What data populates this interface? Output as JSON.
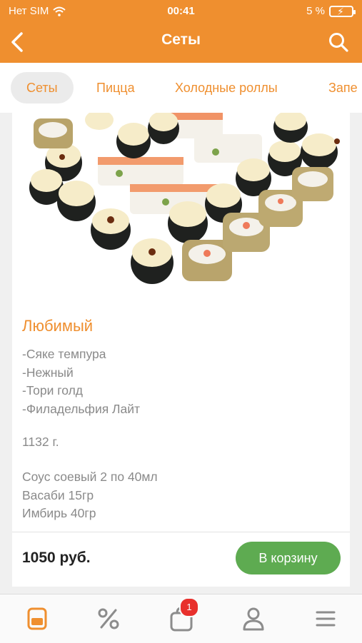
{
  "status_bar": {
    "carrier": "Нет SIM",
    "time": "00:41",
    "battery": "5 %"
  },
  "header": {
    "title": "Сеты",
    "back_icon": "chevron-left-icon",
    "search_icon": "search-icon"
  },
  "tabs": [
    {
      "label": "Сеты",
      "active": true
    },
    {
      "label": "Пицца",
      "active": false
    },
    {
      "label": "Холодные роллы",
      "active": false
    },
    {
      "label": "Запе",
      "active": false
    }
  ],
  "product": {
    "name": "Любимый",
    "description": [
      "-Сяке темпура",
      "-Нежный",
      "-Тори голд",
      "-Филадельфия Лайт"
    ],
    "weight": "1132 г.",
    "extras": [
      "Соус соевый 2 по 40мл",
      "Васаби 15гр",
      "Имбирь 40гр"
    ],
    "price": "1050 руб.",
    "cart_button": "В корзину"
  },
  "bottom_nav": {
    "items": [
      {
        "icon": "menu-card-icon",
        "active": true
      },
      {
        "icon": "percent-icon",
        "active": false
      },
      {
        "icon": "cart-bag-icon",
        "active": false,
        "badge": "1"
      },
      {
        "icon": "profile-icon",
        "active": false
      },
      {
        "icon": "hamburger-menu-icon",
        "active": false
      }
    ]
  },
  "colors": {
    "accent": "#ef8f2f",
    "button_green": "#5eab51",
    "badge_red": "#e8302c",
    "text_gray": "#8a8a8a"
  }
}
